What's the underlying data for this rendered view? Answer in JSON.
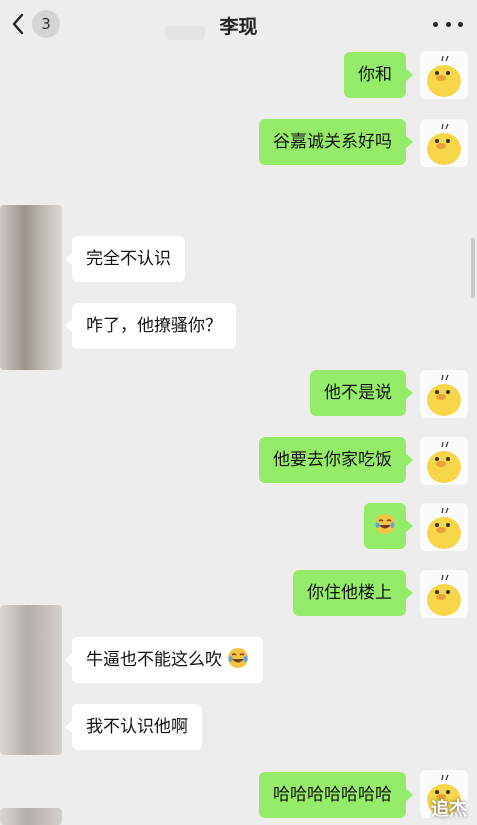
{
  "header": {
    "back_label": "返回",
    "unread_count": "3",
    "title": "李现"
  },
  "messages": [
    {
      "side": "right",
      "text": "你和"
    },
    {
      "side": "right",
      "text": "谷嘉诚关系好吗"
    },
    {
      "side": "left",
      "text": "完全不认识"
    },
    {
      "side": "left",
      "text": "咋了，他撩骚你？"
    },
    {
      "side": "right",
      "text": "他不是说"
    },
    {
      "side": "right",
      "text": "他要去你家吃饭"
    },
    {
      "side": "right",
      "text": "",
      "emoji": "laugh-cry-emoji"
    },
    {
      "side": "right",
      "text": "你住他楼上"
    },
    {
      "side": "left",
      "text": "牛逼也不能这么吹",
      "emoji": "laugh-cry-emoji"
    },
    {
      "side": "left",
      "text": "我不认识他啊"
    },
    {
      "side": "right",
      "text": "哈哈哈哈哈哈哈"
    }
  ],
  "watermark": "追杰",
  "colors": {
    "background": "#ededed",
    "bubble_right": "#95ec69",
    "bubble_left": "#ffffff",
    "avatar_chick": "#f7d64a"
  },
  "icons": {
    "back": "chevron-left-icon",
    "more": "more-dots-icon",
    "my_avatar": "yellow-chick-avatar",
    "emoji": "laugh-cry-emoji"
  }
}
